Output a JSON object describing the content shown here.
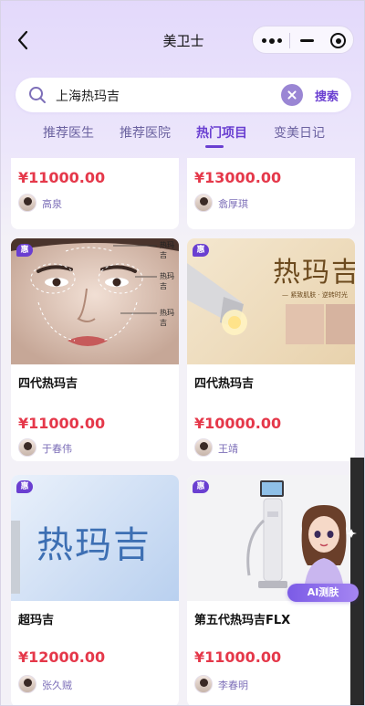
{
  "nav": {
    "title": "美卫士"
  },
  "search": {
    "query": "上海热玛吉",
    "button": "搜索"
  },
  "tabs": [
    {
      "label": "推荐医生",
      "active": false
    },
    {
      "label": "推荐医院",
      "active": false
    },
    {
      "label": "热门项目",
      "active": true
    },
    {
      "label": "变美日记",
      "active": false
    }
  ],
  "cards": [
    {
      "title": "",
      "price": "¥11000.00",
      "doctor": "高泉",
      "badge": ""
    },
    {
      "title": "",
      "price": "¥13000.00",
      "doctor": "翕厚琪",
      "badge": ""
    },
    {
      "title": "四代热玛吉",
      "price": "¥11000.00",
      "doctor": "于春伟",
      "badge": "惠",
      "image_labels": [
        "热玛吉",
        "热玛吉",
        "热玛吉"
      ]
    },
    {
      "title": "四代热玛吉",
      "price": "¥10000.00",
      "doctor": "王靖",
      "badge": "惠",
      "image_text": "热玛吉",
      "image_subtext": "— 紧致肌肤 · 逆转时光"
    },
    {
      "title": "超玛吉",
      "price": "¥12000.00",
      "doctor": "张久贼",
      "badge": "惠",
      "image_text": "热玛吉"
    },
    {
      "title": "第五代热玛吉FLX",
      "price": "¥11000.00",
      "doctor": "李春明",
      "badge": "惠"
    }
  ],
  "ai_assistant": {
    "label": "AI测肤"
  },
  "colors": {
    "accent": "#6a3fd1",
    "price": "#e5384a",
    "tab_inactive": "#6b62a0"
  }
}
